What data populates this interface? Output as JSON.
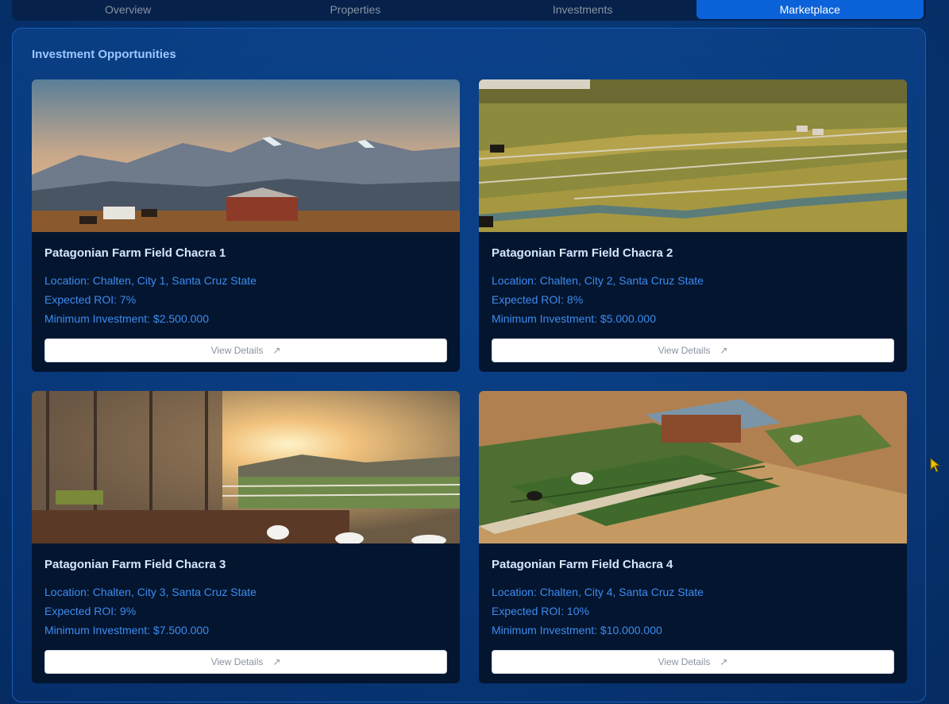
{
  "tabs": [
    "Overview",
    "Properties",
    "Investments",
    "Marketplace"
  ],
  "active_tab": "Marketplace",
  "section_title": "Investment Opportunities",
  "button_label": "View Details",
  "cards": [
    {
      "title": "Patagonian Farm Field Chacra 1",
      "location": "Location: Chalten, City 1, Santa Cruz State",
      "roi": "Expected ROI: 7%",
      "min_investment": "Minimum Investment: $2.500.000",
      "image": "mountain-farm-sunset"
    },
    {
      "title": "Patagonian Farm Field Chacra 2",
      "location": "Location: Chalten, City 2, Santa Cruz State",
      "roi": "Expected ROI: 8%",
      "min_investment": "Minimum Investment: $5.000.000",
      "image": "fenced-pasture-cattle"
    },
    {
      "title": "Patagonian Farm Field Chacra 3",
      "location": "Location: Chalten, City 3, Santa Cruz State",
      "roi": "Expected ROI: 9%",
      "min_investment": "Minimum Investment: $7.500.000",
      "image": "barn-porch-sunrise"
    },
    {
      "title": "Patagonian Farm Field Chacra 4",
      "location": "Location: Chalten, City 4, Santa Cruz State",
      "roi": "Expected ROI: 10%",
      "min_investment": "Minimum Investment: $10.000.000",
      "image": "aerial-farm-crops-cows"
    }
  ],
  "colors": {
    "accent": "#0c62d8",
    "card_bg": "#04152f",
    "meta_text": "#3c8cf0",
    "title_text": "#d6e6ff"
  }
}
